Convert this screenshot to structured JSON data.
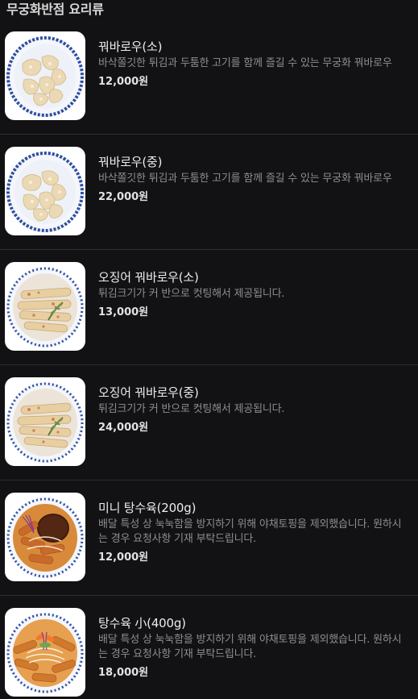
{
  "section": {
    "title": "무궁화반점 요리류"
  },
  "items": [
    {
      "name": "꿔바로우(소)",
      "desc": "바삭쫄깃한 튀김과 두툼한 고기를 함께 즐길 수 있는 무궁화 꿔바로우",
      "price": "12,000원",
      "image": "guobaorou-plate-photo"
    },
    {
      "name": "꿔바로우(중)",
      "desc": "바삭쫄깃한 튀김과 두툼한 고기를 함께 즐길 수 있는 무궁화 꿔바로우",
      "price": "22,000원",
      "image": "guobaorou-plate-photo"
    },
    {
      "name": "오징어 꿔바로우(소)",
      "desc": "튀김크기가 커 반으로 컷팅해서 제공됩니다.",
      "price": "13,000원",
      "image": "squid-guobaorou-plate-photo"
    },
    {
      "name": "오징어 꿔바로우(중)",
      "desc": "튀김크기가 커 반으로 컷팅해서 제공됩니다.",
      "price": "24,000원",
      "image": "squid-guobaorou-plate-photo"
    },
    {
      "name": "미니 탕수육(200g)",
      "desc": "배달 특성 상 눅눅함을 방지하기 위해 야채토핑을 제외했습니다. 원하시는 경우 요청사항 기재 부탁드립니다.",
      "price": "12,000원",
      "image": "tangsuyuk-sauce-plate-photo"
    },
    {
      "name": "탕수육 小(400g)",
      "desc": "배달 특성 상 눅눅함을 방지하기 위해 야채토핑을 제외했습니다. 원하시는 경우 요청사항 기재 부탁드립니다.",
      "price": "18,000원",
      "image": "tangsuyuk-plate-photo"
    }
  ]
}
